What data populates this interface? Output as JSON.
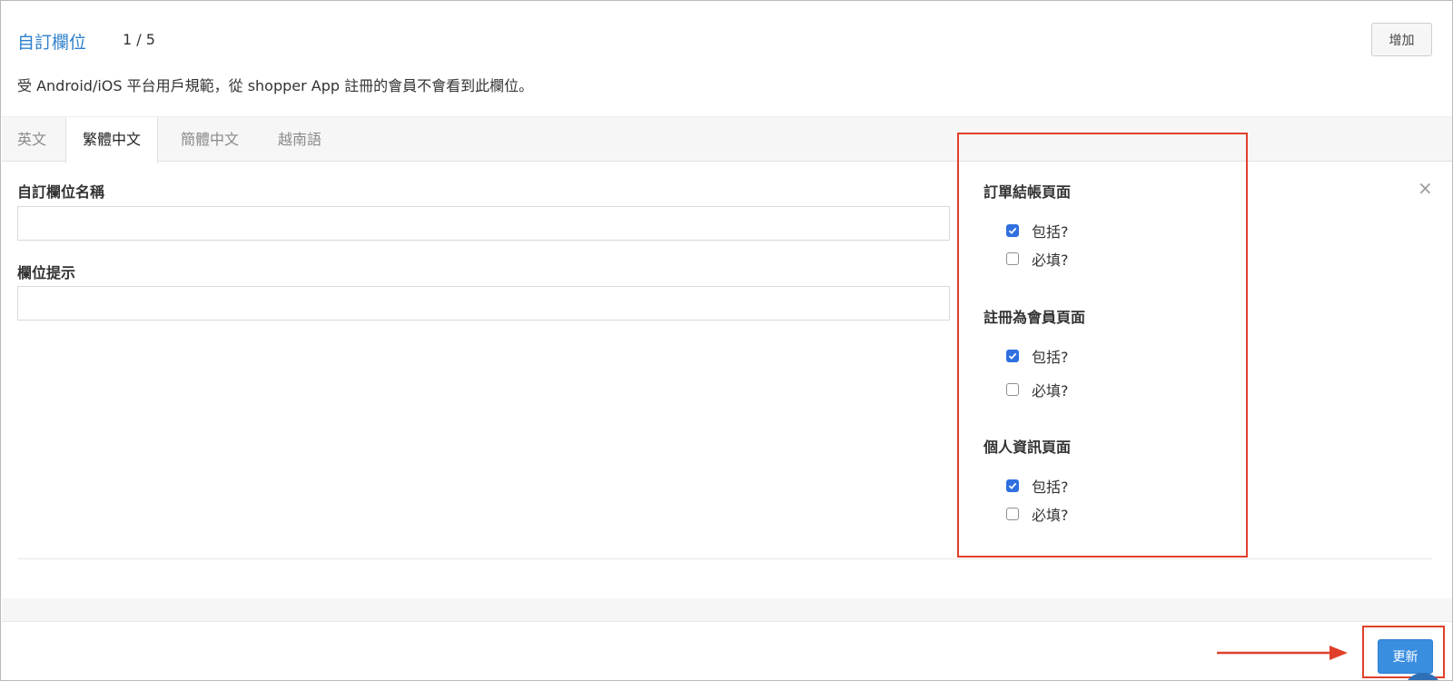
{
  "header": {
    "title": "自訂欄位",
    "counter": "1 / 5",
    "add_label": "增加"
  },
  "notice": "受 Android/iOS 平台用戶規範，從 shopper App 註冊的會員不會看到此欄位。",
  "tabs": [
    {
      "label": "英文",
      "active": false
    },
    {
      "label": "繁體中文",
      "active": true
    },
    {
      "label": "簡體中文",
      "active": false
    },
    {
      "label": "越南語",
      "active": false
    }
  ],
  "form": {
    "name_label": "自訂欄位名稱",
    "name_value": "",
    "hint_label": "欄位提示",
    "hint_value": ""
  },
  "visibility": {
    "sections": [
      {
        "heading": "訂單結帳頁面",
        "options": [
          {
            "label": "包括?",
            "checked": true
          },
          {
            "label": "必填?",
            "checked": false
          }
        ]
      },
      {
        "heading": "註冊為會員頁面",
        "options": [
          {
            "label": "包括?",
            "checked": true
          },
          {
            "label": "必填?",
            "checked": false
          }
        ]
      },
      {
        "heading": "個人資訊頁面",
        "options": [
          {
            "label": "包括?",
            "checked": true
          },
          {
            "label": "必填?",
            "checked": false
          }
        ]
      }
    ]
  },
  "close_icon": "×",
  "footer": {
    "update_label": "更新"
  },
  "colors": {
    "title_blue": "#2f80cc",
    "checkbox_blue": "#2f6fe0",
    "button_blue": "#3a8ee0",
    "annotation_red": "#e0402a"
  }
}
